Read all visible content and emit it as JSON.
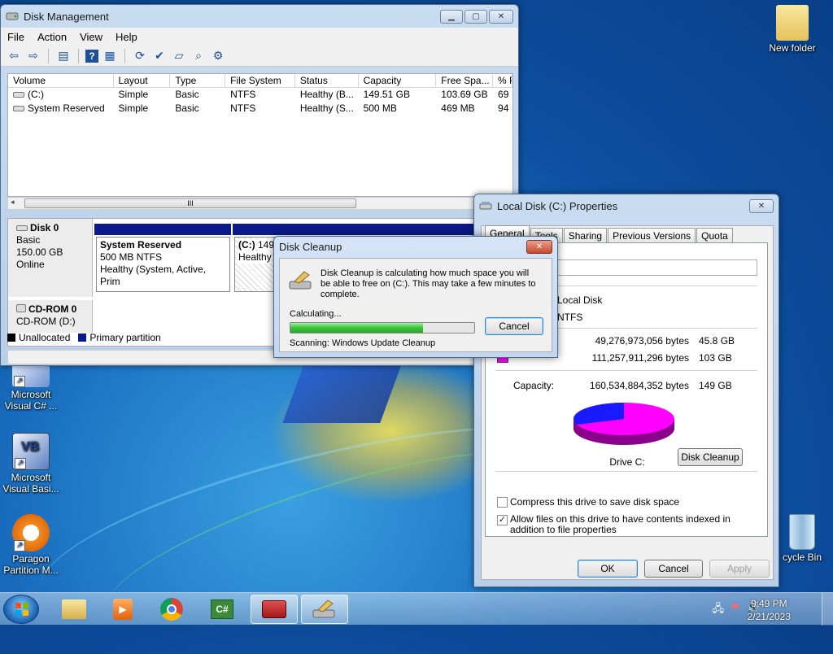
{
  "desktop": {
    "icons": {
      "new_folder": "New folder",
      "vcsharp": "Microsoft Visual C# ...",
      "vbasic": "Microsoft Visual Basi...",
      "paragon": "Paragon Partition M...",
      "recycle": "cycle Bin"
    }
  },
  "diskmgmt": {
    "title": "Disk Management",
    "menu": [
      "File",
      "Action",
      "View",
      "Help"
    ],
    "columns": [
      "Volume",
      "Layout",
      "Type",
      "File System",
      "Status",
      "Capacity",
      "Free Spa...",
      "% F"
    ],
    "rows": [
      [
        "(C:)",
        "Simple",
        "Basic",
        "NTFS",
        "Healthy (B...",
        "149.51 GB",
        "103.69 GB",
        "69"
      ],
      [
        "System Reserved",
        "Simple",
        "Basic",
        "NTFS",
        "Healthy (S...",
        "500 MB",
        "469 MB",
        "94"
      ]
    ],
    "scroll_grip": "III",
    "disk0": {
      "name": "Disk 0",
      "type": "Basic",
      "size": "150.00 GB",
      "state": "Online"
    },
    "sysres": {
      "name": "System Reserved",
      "size": "500 MB NTFS",
      "status": "Healthy (System, Active, Prim"
    },
    "cpart": {
      "name": "(C:)",
      "size": "149.51 G",
      "status": "Healthy"
    },
    "cdrom": {
      "name": "CD-ROM 0",
      "drive": "CD-ROM (D:)"
    },
    "legend": {
      "unallocated": "Unallocated",
      "primary": "Primary partition"
    }
  },
  "props": {
    "title": "Local Disk (C:) Properties",
    "tabs": [
      "General",
      "Tools",
      "Sharing",
      "Previous Versions",
      "Quota"
    ],
    "type_label": "Local Disk",
    "fs": "NTFS",
    "used_bytes": "49,276,973,056 bytes",
    "used_gb": "45.8 GB",
    "free_bytes": "111,257,911,296 bytes",
    "free_gb": "103 GB",
    "capacity_label": "Capacity:",
    "capacity_bytes": "160,534,884,352 bytes",
    "capacity_gb": "149 GB",
    "drive_label": "Drive C:",
    "cleanup_btn": "Disk Cleanup",
    "compress_label": "Compress this drive to save disk space",
    "index_label": "Allow files on this drive to have contents indexed in addition to file properties",
    "ok": "OK",
    "cancel": "Cancel",
    "apply": "Apply",
    "used_color": "#1a1aff",
    "free_color": "#ff00ff"
  },
  "cleanup": {
    "title": "Disk Cleanup",
    "message": "Disk Cleanup is calculating how much space you will be able to free on  (C:). This may take a few minutes to complete.",
    "calculating": "Calculating...",
    "cancel": "Cancel",
    "scanning": "Scanning:  Windows Update Cleanup",
    "progress": 0.72
  },
  "taskbar": {
    "time": "9:49 PM",
    "date": "2/21/2023"
  }
}
